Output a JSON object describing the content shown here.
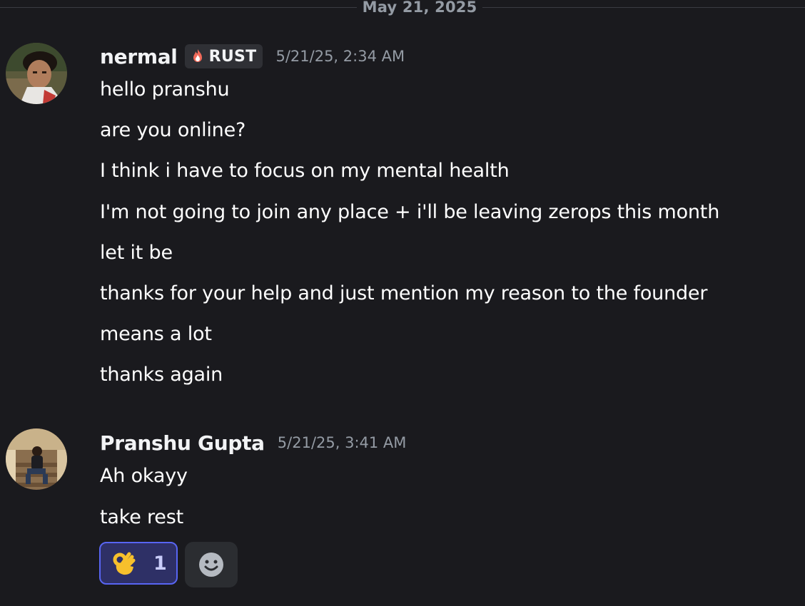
{
  "date_divider": "May 21, 2025",
  "messages": [
    {
      "author": "nermal",
      "tag": "RUST",
      "tag_icon": "fire-icon",
      "timestamp": "5/21/25, 2:34 AM",
      "lines": [
        "hello pranshu",
        "are you online?",
        "I think i have to focus on my mental health",
        "I'm not going to join any place + i'll be leaving zerops this month",
        "let it be",
        "thanks for your help and just mention my reason to the founder",
        "means a lot",
        "thanks again"
      ]
    },
    {
      "author": "Pranshu Gupta",
      "timestamp": "5/21/25, 3:41 AM",
      "lines": [
        "Ah okayy",
        "take rest"
      ],
      "reactions": [
        {
          "emoji": "ok-hand-icon",
          "count": "1",
          "active": true
        }
      ],
      "add_reaction_icon": "add-reaction-smiley-icon"
    }
  ],
  "colors": {
    "background": "#1a1a1e",
    "muted_text": "#949ba4",
    "accent": "#5865f2"
  }
}
